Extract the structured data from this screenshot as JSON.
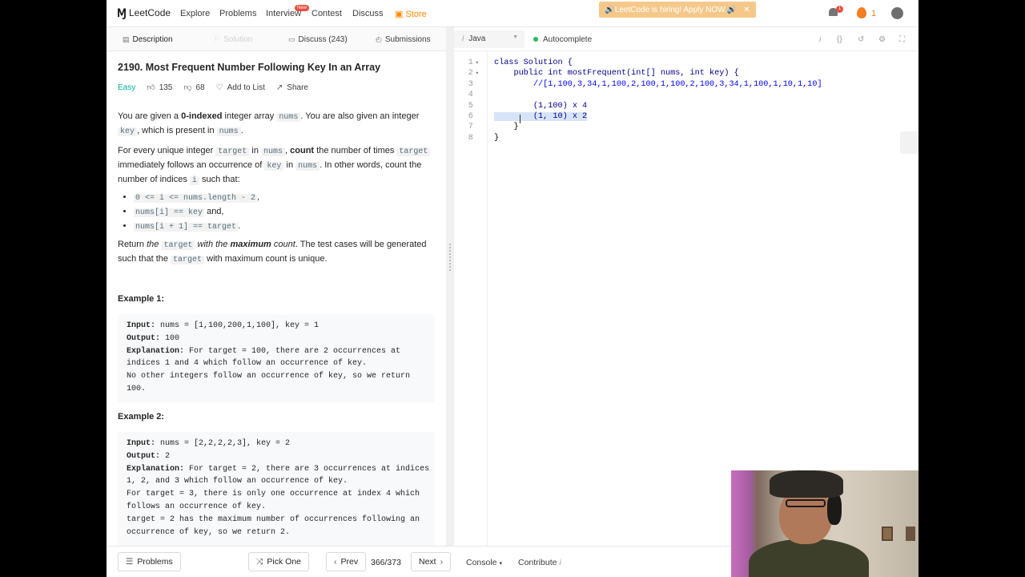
{
  "nav": {
    "logo": "LeetCode",
    "explore": "Explore",
    "problems": "Problems",
    "interview": "Interview",
    "new_badge": "New",
    "contest": "Contest",
    "discuss": "Discuss",
    "store": "Store",
    "hiring_banner": "🔊LeetCode is hiring! Apply NOW.🔊",
    "hiring_close": "✕",
    "notif_count": "1",
    "streak_count": "1"
  },
  "left_tabs": {
    "description": "Description",
    "solution": "Solution",
    "discuss": "Discuss (243)",
    "submissions": "Submissions"
  },
  "problem": {
    "title": "2190. Most Frequent Number Following Key In an Array",
    "difficulty": "Easy",
    "likes": "135",
    "dislikes": "68",
    "add_to_list": "Add to List",
    "share": "Share",
    "p1_a": "You are given a ",
    "p1_b": "0-indexed",
    "p1_c": " integer array ",
    "p1_code1": "nums",
    "p1_d": ". You are also given an integer ",
    "p1_code2": "key",
    "p1_e": ", which is present in ",
    "p1_code3": "nums",
    "p1_f": ".",
    "p2_a": "For every unique integer ",
    "p2_code1": "target",
    "p2_b": " in ",
    "p2_code2": "nums",
    "p2_c": ", ",
    "p2_bold": "count",
    "p2_d": " the number of times ",
    "p2_code3": "target",
    "p2_e": " immediately follows an occurrence of ",
    "p2_code4": "key",
    "p2_f": " in ",
    "p2_code5": "nums",
    "p2_g": ". In other words, count the number of indices ",
    "p2_code6": "i",
    "p2_h": " such that:",
    "bullet1_code": "0 <= i <= nums.length - 2",
    "bullet1_tail": ",",
    "bullet2_code": "nums[i] == key",
    "bullet2_tail": " and,",
    "bullet3_code": "nums[i + 1] == target",
    "bullet3_tail": ".",
    "p3_a": "Return ",
    "p3_i1": "the ",
    "p3_code1": "target",
    "p3_i2": " with the ",
    "p3_bi": "maximum",
    "p3_i3": " count",
    "p3_b": ". The test cases will be generated such that the ",
    "p3_code2": "target",
    "p3_c": " with maximum count is unique.",
    "example1_heading": "Example 1:",
    "ex1_input_label": "Input:",
    "ex1_input": " nums = [1,100,200,1,100], key = 1",
    "ex1_output_label": "Output:",
    "ex1_output": " 100",
    "ex1_expl_label": "Explanation:",
    "ex1_expl": " For target = 100, there are 2 occurrences at\nindices 1 and 4 which follow an occurrence of key.\nNo other integers follow an occurrence of key, so we return\n100.",
    "example2_heading": "Example 2:",
    "ex2_input_label": "Input:",
    "ex2_input": " nums = [2,2,2,2,3], key = 2",
    "ex2_output_label": "Output:",
    "ex2_output": " 2",
    "ex2_expl_label": "Explanation:",
    "ex2_expl": " For target = 2, there are 3 occurrences at indices\n1, 2, and 3 which follow an occurrence of key.\nFor target = 3, there is only one occurrence at index 4 which\nfollows an occurrence of key.\ntarget = 2 has the maximum number of occurrences following an\noccurrence of key, so we return 2."
  },
  "editor": {
    "language": "Java",
    "autocomplete": "Autocomplete",
    "line_numbers": [
      "1",
      "2",
      "3",
      "4",
      "5",
      "6",
      "7",
      "8"
    ],
    "lines": [
      "class Solution {",
      "    public int mostFrequent(int[] nums, int key) {",
      "        //[1,100,3,34,1,100,2,100,1,100,2,100,3,34,1,100,1,10,1,10]",
      "",
      "        (1,100) x 4",
      "        (1, 10) x 2",
      "    }",
      "}"
    ]
  },
  "bottom": {
    "problems": "Problems",
    "pick_one": "Pick One",
    "prev": "Prev",
    "counter": "366/373",
    "next": "Next",
    "console": "Console",
    "contribute": "Contribute"
  },
  "colors": {
    "easy": "#00af9b",
    "store": "#ff8a00",
    "autocomplete_dot": "#2db55d",
    "selection": "#d7e4f8"
  }
}
